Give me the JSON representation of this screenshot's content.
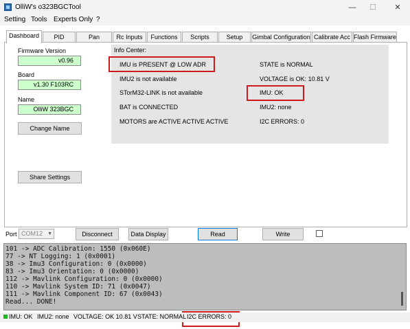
{
  "window": {
    "title": "OlliW's o323BGCTool",
    "minimize": "—",
    "maximize": "☐",
    "close": "✕"
  },
  "menu": [
    "Setting",
    "Tools",
    "Experts Only",
    "?"
  ],
  "tabs": [
    "Dashboard",
    "PID",
    "Pan",
    "Rc Inputs",
    "Functions",
    "Scripts",
    "Setup",
    "Gimbal Configuration",
    "Calibrate Acc",
    "Flash Firmware"
  ],
  "active_tab": "Dashboard",
  "dashboard": {
    "firmware_label": "Firmware Version",
    "firmware_value": "v0.96",
    "board_label": "Board",
    "board_value": "v1.30 F103RC",
    "name_label": "Name",
    "name_value": "OlliW 323BGC",
    "change_name": "Change Name",
    "share_settings": "Share Settings"
  },
  "info_center": {
    "title": "Info Center:",
    "left": [
      "IMU is PRESENT @ LOW ADR",
      "IMU2 is not available",
      "STorM32-LINK is not available",
      "BAT is CONNECTED",
      "MOTORS are ACTIVE ACTIVE ACTIVE"
    ],
    "right": [
      "STATE is NORMAL",
      "VOLTAGE is OK: 10.81 V",
      "IMU: OK",
      "IMU2: none",
      "I2C ERRORS: 0"
    ]
  },
  "controls": {
    "port_label": "Port",
    "port_value": "COM12",
    "disconnect": "Disconnect",
    "data_display": "Data Display",
    "read": "Read",
    "write": "Write"
  },
  "log": [
    "101 -> ADC Calibration: 1550 (0x060E)",
    "77 -> NT Logging: 1 (0x0001)",
    "38 -> Imu3 Configuration: 0 (0x0000)",
    "83 -> Imu3 Orientation: 0 (0x0000)",
    "112 -> Mavlink Configuration: 0 (0x0000)",
    "110 -> Mavlink System ID: 71 (0x0047)",
    "111 -> Mavlink Component ID: 67 (0x0043)",
    "Read... DONE!"
  ],
  "status": {
    "imu": "IMU: OK",
    "imu2": "IMU2: none",
    "voltage": "VOLTAGE: OK 10.81 V",
    "state": "STATE: NORMAL",
    "i2c": "I2C ERRORS: 0"
  },
  "colors": {
    "highlight": "#d01919",
    "value_bg": "#ccffcc",
    "info_bg": "#e5e5e5",
    "log_bg": "#bdbdbd",
    "led": "#1fb31f"
  }
}
